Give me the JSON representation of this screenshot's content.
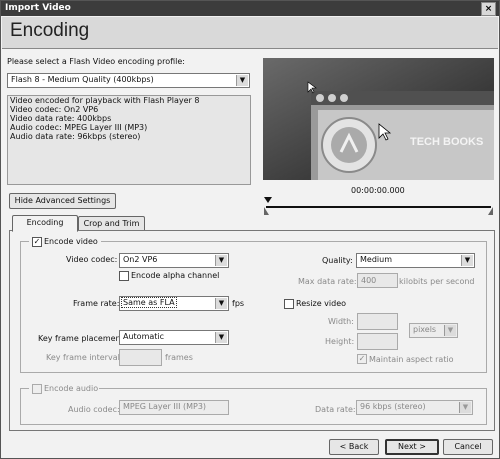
{
  "window": {
    "title": "Import Video",
    "close_glyph": "×"
  },
  "header": {
    "title": "Encoding"
  },
  "profile": {
    "prompt": "Please select a Flash Video encoding profile:",
    "selected": "Flash 8 - Medium Quality (400kbps)",
    "details": [
      "Video encoded for playback with Flash Player 8",
      "Video codec: On2 VP6",
      "Video data rate: 400kbps",
      "Audio codec: MPEG Layer III (MP3)",
      "Audio data rate: 96kbps (stereo)"
    ]
  },
  "preview": {
    "banner_text": "TECH BOOKS",
    "timecode": "00:00:00.000"
  },
  "advanced_button": "Hide Advanced Settings",
  "tabs": {
    "encoding": "Encoding",
    "crop_trim": "Crop and Trim"
  },
  "video": {
    "encode_video_label": "Encode video",
    "codec_label": "Video codec:",
    "codec_value": "On2 VP6",
    "alpha_label": "Encode alpha channel",
    "quality_label": "Quality:",
    "quality_value": "Medium",
    "max_rate_label": "Max data rate:",
    "max_rate_value": "400",
    "max_rate_unit": "kilobits per second",
    "frame_rate_label": "Frame rate:",
    "frame_rate_value": "Same as FLA",
    "fps_unit": "fps",
    "resize_label": "Resize video",
    "width_label": "Width:",
    "height_label": "Height:",
    "units_value": "pixels",
    "aspect_label": "Maintain aspect ratio",
    "keyframe_label": "Key frame placement:",
    "keyframe_value": "Automatic",
    "keyframe_interval_label": "Key frame interval:",
    "frames_unit": "frames"
  },
  "audio": {
    "encode_audio_label": "Encode audio",
    "codec_label": "Audio codec:",
    "codec_value": "MPEG Layer III (MP3)",
    "rate_label": "Data rate:",
    "rate_value": "96 kbps (stereo)"
  },
  "footer": {
    "back": "< Back",
    "next": "Next >",
    "cancel": "Cancel"
  },
  "icons": {
    "dropdown": "▼",
    "check": "✓"
  }
}
